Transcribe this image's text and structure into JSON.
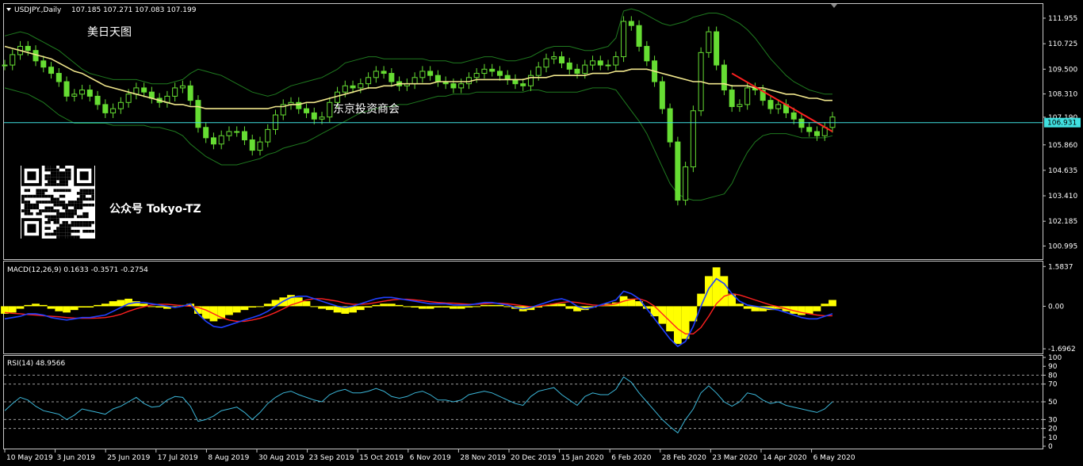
{
  "header": {
    "symbol": "USDJPY.,Daily",
    "ohlc": "107.185 107.271 107.083 107.199",
    "macd": "MACD(12,26,9) 0.1633 -0.3571 -0.2754",
    "rsi": "RSI(14) 48.9566"
  },
  "watermarks": {
    "title_cn": "美日天图",
    "firm_cn": "东京投资商会",
    "account": "公众号 Tokyo-TZ"
  },
  "price_axis": {
    "ticks": [
      "111.955",
      "110.725",
      "109.500",
      "108.310",
      "107.190",
      "106.931",
      "105.860",
      "104.635",
      "103.410",
      "102.185",
      "100.995"
    ],
    "current_price": "106.931",
    "current_price_value": 106.931
  },
  "macd_axis": {
    "ticks": [
      "1.5837",
      "0.00",
      "-1.6962"
    ]
  },
  "rsi_axis": {
    "ticks": [
      "100",
      "90",
      "80",
      "70",
      "50",
      "30",
      "20",
      "10",
      "0"
    ]
  },
  "date_labels": [
    "10 May 2019",
    "3 Jun 2019",
    "25 Jun 2019",
    "17 Jul 2019",
    "8 Aug 2019",
    "30 Aug 2019",
    "23 Sep 2019",
    "15 Oct 2019",
    "6 Nov 2019",
    "28 Nov 2019",
    "20 Dec 2019",
    "15 Jan 2020",
    "6 Feb 2020",
    "28 Feb 2020",
    "23 Mar 2020",
    "14 Apr 2020",
    "6 May 2020"
  ],
  "chart_data": {
    "type": "line",
    "price": {
      "ylim": [
        100.4,
        112.6
      ],
      "close_series": [
        109.7,
        110.2,
        110.6,
        110.4,
        109.9,
        109.6,
        109.3,
        108.9,
        108.2,
        108.3,
        108.5,
        108.2,
        107.8,
        107.4,
        107.6,
        107.9,
        108.3,
        108.6,
        108.4,
        108.1,
        107.9,
        108.2,
        108.6,
        108.7,
        108.0,
        106.7,
        106.2,
        105.9,
        106.3,
        106.5,
        106.5,
        106.1,
        105.6,
        106.0,
        106.6,
        107.3,
        107.8,
        107.9,
        107.6,
        107.4,
        107.1,
        107.2,
        107.9,
        108.4,
        108.7,
        108.6,
        108.8,
        109.1,
        109.4,
        109.3,
        108.9,
        108.7,
        108.8,
        109.1,
        109.4,
        109.2,
        108.9,
        108.8,
        108.6,
        108.8,
        109.1,
        109.3,
        109.5,
        109.4,
        109.2,
        109.0,
        108.8,
        108.7,
        109.2,
        109.6,
        110.0,
        110.1,
        109.8,
        109.5,
        109.3,
        109.7,
        109.9,
        109.7,
        109.7,
        110.1,
        111.8,
        111.6,
        110.6,
        109.9,
        108.9,
        107.6,
        106.0,
        103.2,
        104.8,
        107.5,
        110.3,
        111.3,
        109.7,
        108.5,
        107.7,
        107.8,
        108.6,
        108.5,
        108.0,
        107.6,
        107.8,
        107.4,
        107.1,
        106.7,
        106.5,
        106.3,
        106.7,
        107.2
      ],
      "ma_series": [
        110.6,
        110.5,
        110.4,
        110.3,
        110.2,
        110.1,
        110.0,
        109.8,
        109.6,
        109.4,
        109.3,
        109.1,
        108.9,
        108.7,
        108.6,
        108.5,
        108.4,
        108.3,
        108.2,
        108.1,
        108.0,
        107.9,
        107.8,
        107.8,
        107.7,
        107.7,
        107.6,
        107.6,
        107.6,
        107.6,
        107.6,
        107.6,
        107.6,
        107.6,
        107.6,
        107.7,
        107.7,
        107.8,
        107.8,
        107.9,
        107.9,
        108.0,
        108.1,
        108.2,
        108.3,
        108.4,
        108.5,
        108.6,
        108.6,
        108.7,
        108.7,
        108.8,
        108.8,
        108.8,
        108.8,
        108.8,
        108.9,
        108.9,
        108.9,
        108.9,
        108.9,
        109.0,
        109.0,
        109.0,
        109.0,
        109.0,
        109.0,
        109.0,
        109.1,
        109.1,
        109.1,
        109.2,
        109.2,
        109.2,
        109.2,
        109.2,
        109.3,
        109.3,
        109.3,
        109.4,
        109.4,
        109.5,
        109.5,
        109.5,
        109.4,
        109.3,
        109.2,
        109.1,
        109.0,
        108.9,
        108.9,
        108.8,
        108.8,
        108.8,
        108.7,
        108.7,
        108.7,
        108.6,
        108.6,
        108.5,
        108.4,
        108.3,
        108.3,
        108.2,
        108.1,
        108.1,
        108.0,
        108.0
      ],
      "upper_band": [
        111.1,
        111.2,
        111.3,
        111.2,
        111.0,
        110.8,
        110.6,
        110.4,
        110.1,
        109.8,
        109.5,
        109.3,
        109.2,
        109.1,
        109.0,
        109.0,
        109.0,
        109.0,
        108.9,
        108.8,
        108.8,
        108.8,
        108.9,
        109.0,
        109.3,
        109.5,
        109.4,
        109.3,
        109.2,
        109.0,
        108.8,
        108.6,
        108.4,
        108.3,
        108.2,
        108.3,
        108.5,
        108.7,
        108.8,
        108.9,
        109.0,
        109.1,
        109.3,
        109.5,
        109.8,
        109.9,
        110.0,
        110.1,
        110.1,
        110.0,
        110.0,
        110.0,
        110.0,
        110.0,
        110.0,
        109.9,
        109.9,
        109.9,
        109.8,
        109.8,
        109.9,
        110.0,
        110.1,
        110.1,
        110.0,
        109.9,
        109.9,
        110.0,
        110.1,
        110.3,
        110.5,
        110.6,
        110.6,
        110.6,
        110.5,
        110.4,
        110.4,
        110.5,
        110.6,
        111.0,
        112.3,
        112.4,
        112.3,
        112.1,
        111.9,
        111.7,
        111.6,
        111.7,
        111.8,
        112.0,
        112.1,
        112.2,
        112.2,
        112.1,
        111.9,
        111.7,
        111.4,
        111.0,
        110.5,
        110.0,
        109.6,
        109.2,
        108.9,
        108.7,
        108.5,
        108.4,
        108.3,
        108.3
      ],
      "lower_band": [
        108.6,
        108.5,
        108.4,
        108.3,
        108.1,
        107.9,
        107.6,
        107.3,
        107.1,
        106.9,
        106.9,
        106.9,
        106.9,
        106.9,
        106.8,
        106.8,
        106.8,
        106.8,
        106.8,
        106.7,
        106.7,
        106.6,
        106.5,
        106.3,
        105.9,
        105.6,
        105.3,
        105.1,
        104.9,
        104.9,
        104.9,
        105.0,
        105.1,
        105.2,
        105.4,
        105.5,
        105.7,
        105.8,
        105.9,
        106.0,
        106.2,
        106.4,
        106.6,
        106.8,
        107.0,
        107.2,
        107.4,
        107.5,
        107.6,
        107.7,
        107.7,
        107.8,
        107.8,
        107.9,
        108.0,
        108.1,
        108.2,
        108.2,
        108.3,
        108.3,
        108.3,
        108.4,
        108.4,
        108.4,
        108.4,
        108.4,
        108.4,
        108.4,
        108.5,
        108.5,
        108.4,
        108.4,
        108.4,
        108.4,
        108.4,
        108.5,
        108.6,
        108.6,
        108.6,
        108.5,
        108.0,
        107.5,
        107.0,
        106.4,
        105.6,
        104.8,
        104.0,
        103.5,
        103.3,
        103.2,
        103.2,
        103.3,
        103.4,
        103.5,
        104.0,
        104.8,
        105.5,
        106.0,
        106.3,
        106.4,
        106.4,
        106.4,
        106.3,
        106.2,
        106.2,
        106.2,
        106.2,
        106.3
      ],
      "trendline": {
        "start": [
          94,
          109.3
        ],
        "end": [
          107,
          106.5
        ]
      }
    },
    "macd": {
      "ylim": [
        -1.85,
        1.75
      ],
      "histogram": [
        -0.3,
        -0.25,
        -0.1,
        0.05,
        0.1,
        0.05,
        -0.1,
        -0.2,
        -0.25,
        -0.15,
        -0.05,
        -0.05,
        0.05,
        0.1,
        0.2,
        0.25,
        0.3,
        0.2,
        0.1,
        0.0,
        -0.05,
        -0.1,
        -0.05,
        0.05,
        0.1,
        -0.3,
        -0.5,
        -0.6,
        -0.5,
        -0.35,
        -0.25,
        -0.15,
        -0.05,
        0.0,
        0.1,
        0.25,
        0.35,
        0.45,
        0.35,
        0.2,
        0.0,
        -0.1,
        -0.15,
        -0.25,
        -0.3,
        -0.25,
        -0.15,
        -0.05,
        0.05,
        0.1,
        0.1,
        0.05,
        0.0,
        -0.05,
        -0.1,
        -0.1,
        -0.05,
        -0.05,
        -0.1,
        -0.1,
        -0.05,
        0.0,
        0.05,
        0.05,
        0.05,
        0.0,
        -0.1,
        -0.2,
        -0.15,
        -0.05,
        0.05,
        0.1,
        0.1,
        -0.1,
        -0.2,
        -0.15,
        -0.05,
        0.05,
        0.1,
        0.15,
        0.4,
        0.3,
        0.2,
        -0.1,
        -0.4,
        -0.7,
        -1.0,
        -1.5,
        -1.3,
        -0.6,
        0.5,
        1.2,
        1.55,
        1.2,
        0.5,
        0.1,
        -0.1,
        -0.2,
        -0.2,
        -0.15,
        -0.1,
        -0.2,
        -0.3,
        -0.35,
        -0.3,
        -0.2,
        0.1,
        0.25
      ],
      "macd_line": [
        -0.5,
        -0.45,
        -0.4,
        -0.3,
        -0.3,
        -0.35,
        -0.45,
        -0.5,
        -0.55,
        -0.5,
        -0.45,
        -0.45,
        -0.4,
        -0.35,
        -0.2,
        -0.05,
        0.1,
        0.15,
        0.15,
        0.1,
        0.05,
        0.0,
        -0.05,
        0.0,
        0.1,
        -0.3,
        -0.6,
        -0.8,
        -0.85,
        -0.75,
        -0.65,
        -0.55,
        -0.45,
        -0.35,
        -0.2,
        0.0,
        0.2,
        0.35,
        0.4,
        0.4,
        0.3,
        0.2,
        0.1,
        0.0,
        -0.05,
        0.0,
        0.1,
        0.2,
        0.3,
        0.35,
        0.35,
        0.3,
        0.25,
        0.2,
        0.15,
        0.1,
        0.1,
        0.1,
        0.05,
        0.05,
        0.05,
        0.1,
        0.15,
        0.15,
        0.1,
        0.05,
        -0.05,
        -0.1,
        -0.05,
        0.05,
        0.15,
        0.25,
        0.3,
        0.2,
        0.0,
        -0.1,
        -0.05,
        0.05,
        0.15,
        0.25,
        0.6,
        0.5,
        0.3,
        -0.1,
        -0.5,
        -0.9,
        -1.3,
        -1.6,
        -1.4,
        -0.8,
        0.0,
        0.7,
        1.1,
        0.9,
        0.5,
        0.2,
        0.05,
        0.0,
        -0.05,
        -0.1,
        -0.15,
        -0.25,
        -0.35,
        -0.45,
        -0.5,
        -0.5,
        -0.4,
        -0.3
      ],
      "signal_line": [
        -0.25,
        -0.28,
        -0.3,
        -0.33,
        -0.35,
        -0.38,
        -0.4,
        -0.42,
        -0.45,
        -0.47,
        -0.48,
        -0.48,
        -0.47,
        -0.45,
        -0.4,
        -0.32,
        -0.2,
        -0.1,
        -0.02,
        0.05,
        0.08,
        0.08,
        0.05,
        0.02,
        0.0,
        -0.05,
        -0.15,
        -0.3,
        -0.45,
        -0.55,
        -0.6,
        -0.6,
        -0.55,
        -0.48,
        -0.38,
        -0.25,
        -0.1,
        0.05,
        0.15,
        0.25,
        0.3,
        0.3,
        0.25,
        0.2,
        0.12,
        0.08,
        0.08,
        0.1,
        0.15,
        0.2,
        0.25,
        0.28,
        0.28,
        0.25,
        0.22,
        0.18,
        0.15,
        0.13,
        0.12,
        0.1,
        0.08,
        0.08,
        0.1,
        0.12,
        0.12,
        0.1,
        0.06,
        0.02,
        -0.02,
        0.0,
        0.05,
        0.1,
        0.15,
        0.18,
        0.15,
        0.1,
        0.05,
        0.03,
        0.05,
        0.1,
        0.2,
        0.28,
        0.3,
        0.2,
        0.0,
        -0.3,
        -0.6,
        -0.9,
        -1.1,
        -1.1,
        -0.85,
        -0.4,
        0.1,
        0.4,
        0.5,
        0.45,
        0.35,
        0.25,
        0.15,
        0.05,
        -0.02,
        -0.1,
        -0.18,
        -0.25,
        -0.3,
        -0.35,
        -0.38,
        -0.38
      ]
    },
    "rsi": {
      "ylim": [
        0,
        100
      ],
      "levels": [
        80,
        70,
        50,
        30,
        20
      ],
      "values": [
        40,
        48,
        55,
        52,
        45,
        40,
        38,
        36,
        30,
        35,
        42,
        40,
        38,
        36,
        42,
        45,
        50,
        55,
        48,
        44,
        45,
        52,
        56,
        55,
        45,
        28,
        30,
        34,
        40,
        42,
        44,
        38,
        30,
        38,
        48,
        55,
        60,
        62,
        58,
        55,
        52,
        50,
        58,
        62,
        64,
        60,
        60,
        62,
        65,
        62,
        56,
        54,
        56,
        60,
        62,
        58,
        52,
        52,
        50,
        52,
        58,
        60,
        62,
        60,
        56,
        52,
        48,
        46,
        56,
        62,
        64,
        66,
        58,
        52,
        46,
        56,
        60,
        58,
        58,
        64,
        78,
        72,
        60,
        50,
        40,
        30,
        22,
        15,
        30,
        42,
        60,
        68,
        60,
        50,
        45,
        50,
        60,
        58,
        52,
        48,
        50,
        46,
        44,
        42,
        40,
        38,
        42,
        50
      ]
    }
  }
}
